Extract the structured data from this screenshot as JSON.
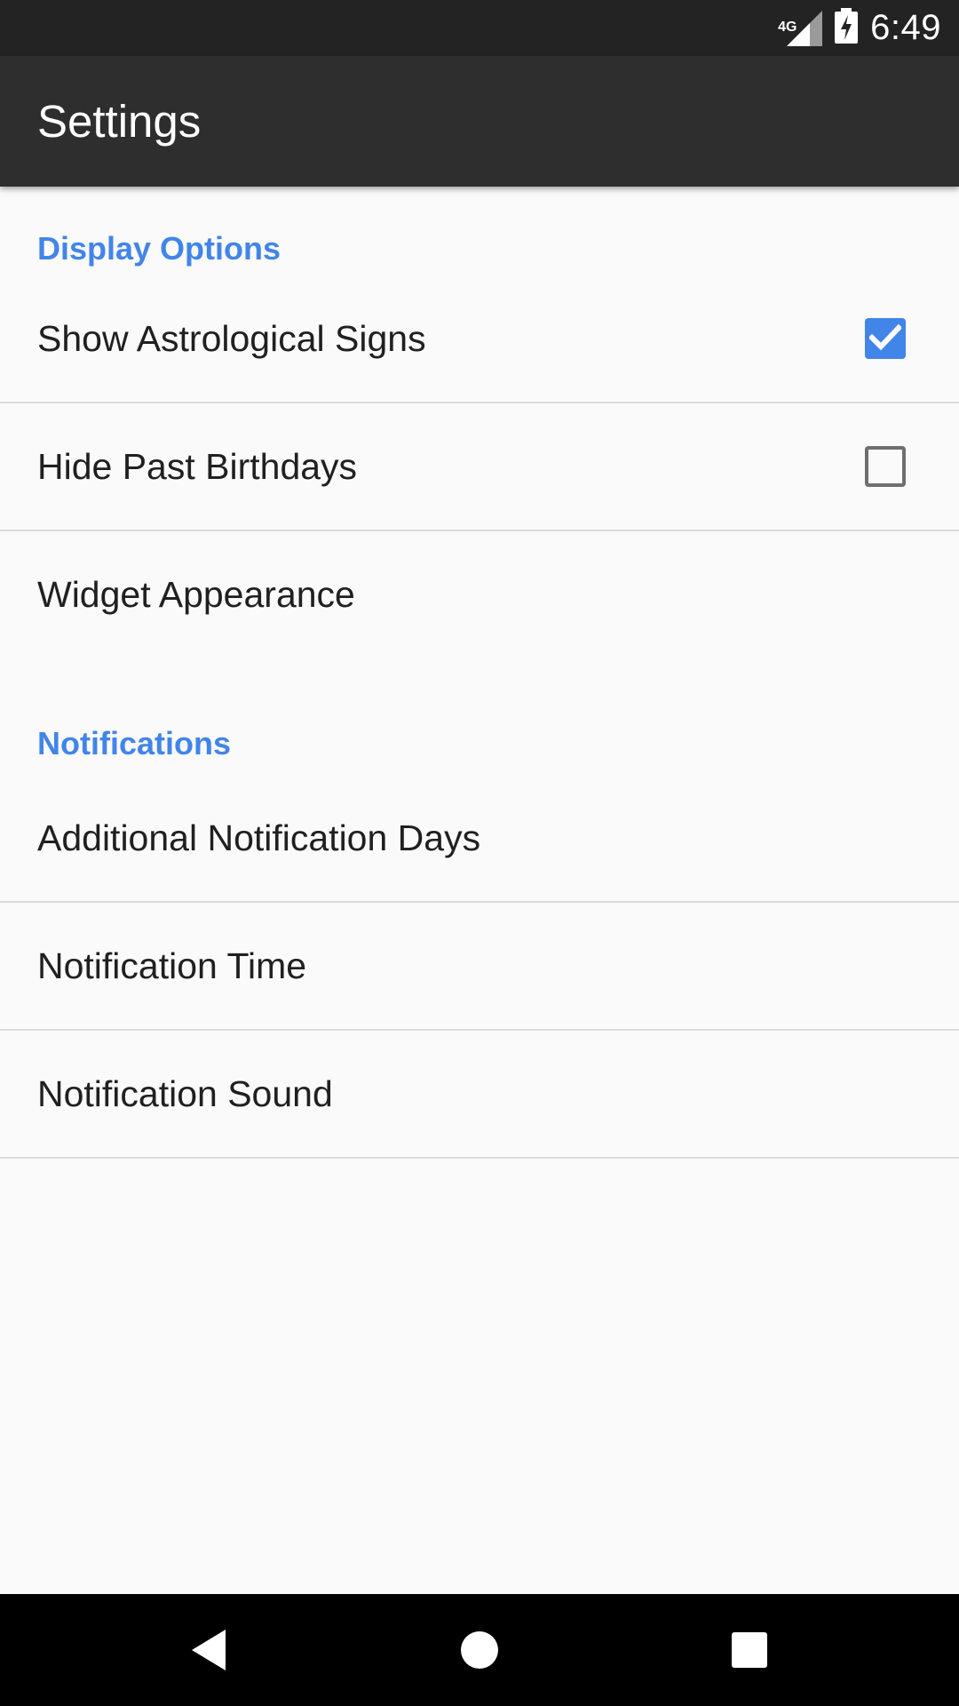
{
  "status_bar": {
    "network": "4G",
    "time": "6:49",
    "icons": [
      "signal-icon",
      "battery-charging-icon"
    ]
  },
  "app_bar": {
    "title": "Settings"
  },
  "sections": [
    {
      "title": "Display Options",
      "items": [
        {
          "label": "Show Astrological Signs",
          "checkbox": true,
          "checked": true
        },
        {
          "label": "Hide Past Birthdays",
          "checkbox": true,
          "checked": false
        },
        {
          "label": "Widget Appearance",
          "checkbox": false
        }
      ]
    },
    {
      "title": "Notifications",
      "items": [
        {
          "label": "Additional Notification Days",
          "checkbox": false
        },
        {
          "label": "Notification Time",
          "checkbox": false
        },
        {
          "label": "Notification Sound",
          "checkbox": false
        }
      ]
    }
  ],
  "nav_bar": {
    "buttons": [
      "back-icon",
      "home-icon",
      "recents-icon"
    ]
  },
  "colors": {
    "accent": "#4285e8",
    "app_bar": "#2e2e2e",
    "status_bar": "#232323",
    "background": "#fafafa"
  }
}
